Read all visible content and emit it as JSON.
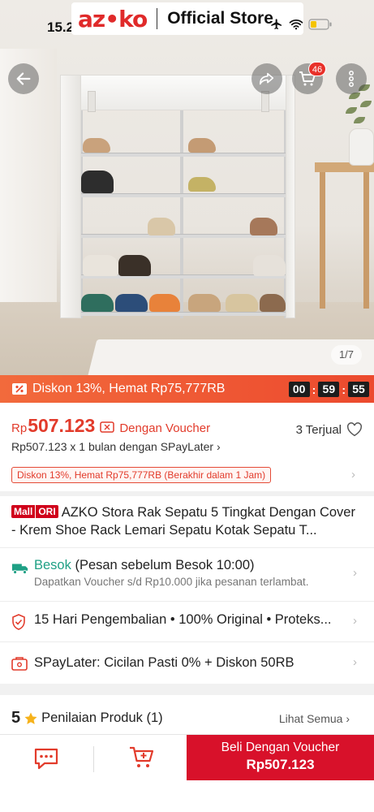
{
  "status_bar": {
    "time": "15.22"
  },
  "brand": {
    "logo": "az•ko",
    "subtitle": "Official Store"
  },
  "header": {
    "back_icon": "back-arrow-icon",
    "share_icon": "share-icon",
    "cart_icon": "cart-icon",
    "more_icon": "more-vertical-icon",
    "cart_badge": "46"
  },
  "gallery": {
    "counter": "1/7"
  },
  "flash_sale": {
    "text": "Diskon 13%, Hemat Rp75,777RB",
    "hours": "00",
    "minutes": "59",
    "seconds": "55"
  },
  "price": {
    "currency": "Rp",
    "amount": "507.123",
    "voucher_label": "Dengan Voucher",
    "sold": "3 Terjual",
    "paylater": "Rp507.123 x 1 bulan dengan SPayLater ›",
    "promo_tag": "Diskon 13%, Hemat Rp75,777RB (Berakhir dalam 1 Jam)"
  },
  "product": {
    "mall_badge": "Mall",
    "ori_badge": "ORI",
    "title": "AZKO Stora Rak Sepatu 5 Tingkat Dengan Cover - Krem Shoe Rack Lemari Sepatu Kotak Sepatu T..."
  },
  "shipping": {
    "highlight": "Besok",
    "main_rest": " (Pesan sebelum Besok 10:00)",
    "sub": "Dapatkan Voucher s/d Rp10.000 jika pesanan terlambat."
  },
  "guarantee": {
    "text": "15 Hari Pengembalian  •  100% Original  •  Proteks..."
  },
  "spaylater": {
    "text": "SPayLater: Cicilan Pasti 0% + Diskon 50RB"
  },
  "rating": {
    "score": "5",
    "label": "Penilaian Produk (1)",
    "see_all": "Lihat Semua ›"
  },
  "bottom_bar": {
    "buy_line1": "Beli Dengan Voucher",
    "buy_line2": "Rp507.123"
  },
  "colors": {
    "accent": "#e23b2b",
    "flash": "#ec4a2e",
    "buy": "#d8112a",
    "green": "#1fa085"
  }
}
